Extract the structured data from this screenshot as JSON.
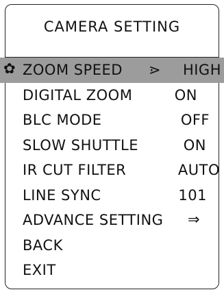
{
  "menu": {
    "title": "CAMERA SETTING",
    "items": [
      {
        "label": "ZOOM SPEED",
        "value": "HIGH",
        "selected": true
      },
      {
        "label": "DIGITAL ZOOM",
        "value": "ON"
      },
      {
        "label": "BLC MODE",
        "value": "OFF"
      },
      {
        "label": "SLOW SHUTTLE",
        "value": "ON"
      },
      {
        "label": "IR CUT FILTER",
        "value": "AUTO"
      },
      {
        "label": "LINE SYNC",
        "value": "101"
      },
      {
        "label": "ADVANCE SETTING",
        "value": ""
      },
      {
        "label": "BACK",
        "value": ""
      },
      {
        "label": "EXIT",
        "value": ""
      }
    ],
    "selected_indicator_icon": "sun-cursor-icon",
    "value_indicator_icon": "chevron-right-icon",
    "submenu_indicator_icon": "double-arrow-right-icon",
    "highlight_color": "#9c9c9c"
  }
}
